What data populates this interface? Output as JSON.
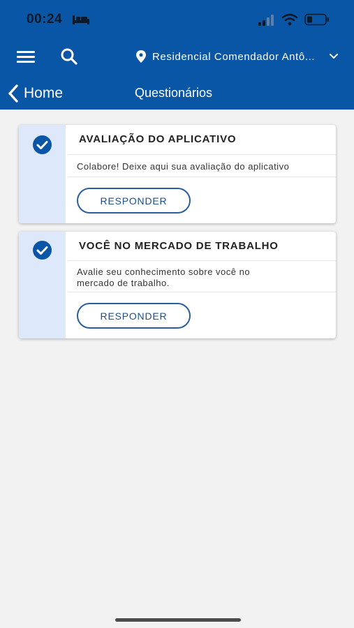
{
  "status_bar": {
    "time": "00:24"
  },
  "nav": {
    "location": "Residencial Comendador Antô..."
  },
  "title_bar": {
    "back_label": "Home",
    "title": "Questionários"
  },
  "questionnaires": [
    {
      "title": "AVALIAÇÃO DO APLICATIVO",
      "description": "Colabore! Deixe aqui sua avaliação do aplicativo",
      "button_label": "RESPONDER",
      "completed": true
    },
    {
      "title": "VOCÊ NO MERCADO DE TRABALHO",
      "description": "Avalie seu conhecimento sobre você no mercado de trabalho.",
      "button_label": "RESPONDER",
      "completed": true
    }
  ],
  "colors": {
    "header_bg": "#0a56a6",
    "accent": "#0a56a6",
    "card_side": "#dde9fa",
    "background": "#f2f2f2"
  },
  "icons": [
    "bed-icon",
    "signal-icon",
    "wifi-icon",
    "battery-icon",
    "menu-icon",
    "search-icon",
    "pin-icon",
    "chevron-down-icon",
    "back-chevron-icon",
    "check-icon"
  ]
}
